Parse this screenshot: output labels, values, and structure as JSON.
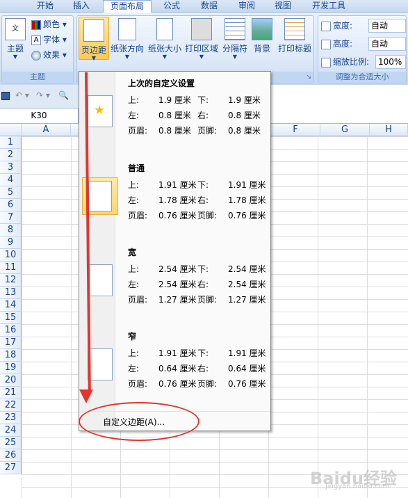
{
  "tabs": [
    {
      "label": "开始"
    },
    {
      "label": "插入"
    },
    {
      "label": "页面布局",
      "active": true
    },
    {
      "label": "公式"
    },
    {
      "label": "数据"
    },
    {
      "label": "审阅"
    },
    {
      "label": "视图"
    },
    {
      "label": "开发工具"
    }
  ],
  "theme_group": {
    "main_label": "主题",
    "colors": "颜色",
    "fonts": "字体",
    "effects": "效果",
    "group_label": "主题"
  },
  "page_setup": {
    "margins": "页边距",
    "orientation": "纸张方向",
    "size": "纸张大小",
    "print_area": "打印区域",
    "breaks": "分隔符",
    "background": "背景",
    "print_titles": "打印标题"
  },
  "scale_group": {
    "width_label": "宽度:",
    "width_value": "自动",
    "height_label": "高度:",
    "height_value": "自动",
    "scale_label": "缩放比例:",
    "scale_value": "100%",
    "group_label": "调整为合适大小"
  },
  "name_box": "K30",
  "columns": [
    "A",
    "F",
    "G",
    "H"
  ],
  "rows": [
    "1",
    "2",
    "3",
    "4",
    "5",
    "6",
    "7",
    "8",
    "9",
    "10",
    "11",
    "12",
    "13",
    "14",
    "15",
    "16",
    "17",
    "18",
    "19",
    "20",
    "21",
    "22",
    "23",
    "24",
    "25",
    "26",
    "27"
  ],
  "margin_menu": {
    "items": [
      {
        "title": "上次的自定义设置",
        "top": "上:",
        "top_v": "1.9 厘米",
        "bottom": "下:",
        "bottom_v": "1.9 厘米",
        "left": "左:",
        "left_v": "0.8 厘米",
        "right": "右:",
        "right_v": "0.8 厘米",
        "header": "页眉:",
        "header_v": "0.8 厘米",
        "footer": "页脚:",
        "footer_v": "0.8 厘米"
      },
      {
        "title": "普通",
        "top": "上:",
        "top_v": "1.91 厘米",
        "bottom": "下:",
        "bottom_v": "1.91 厘米",
        "left": "左:",
        "left_v": "1.78 厘米",
        "right": "右:",
        "right_v": "1.78 厘米",
        "header": "页眉:",
        "header_v": "0.76 厘米",
        "footer": "页脚:",
        "footer_v": "0.76 厘米"
      },
      {
        "title": "宽",
        "top": "上:",
        "top_v": "2.54 厘米",
        "bottom": "下:",
        "bottom_v": "2.54 厘米",
        "left": "左:",
        "left_v": "2.54 厘米",
        "right": "右:",
        "right_v": "2.54 厘米",
        "header": "页眉:",
        "header_v": "1.27 厘米",
        "footer": "页脚:",
        "footer_v": "1.27 厘米"
      },
      {
        "title": "窄",
        "top": "上:",
        "top_v": "1.91 厘米",
        "bottom": "下:",
        "bottom_v": "1.91 厘米",
        "left": "左:",
        "left_v": "0.64 厘米",
        "right": "右:",
        "right_v": "0.64 厘米",
        "header": "页眉:",
        "header_v": "0.76 厘米",
        "footer": "页脚:",
        "footer_v": "0.76 厘米"
      }
    ],
    "custom_label": "自定义边距(A)..."
  },
  "watermark": {
    "main": "Baidu经验",
    "sub": "jingyan.baidu.com"
  },
  "colors": {
    "annotation": "#e3342f",
    "accent": "#15428b"
  }
}
